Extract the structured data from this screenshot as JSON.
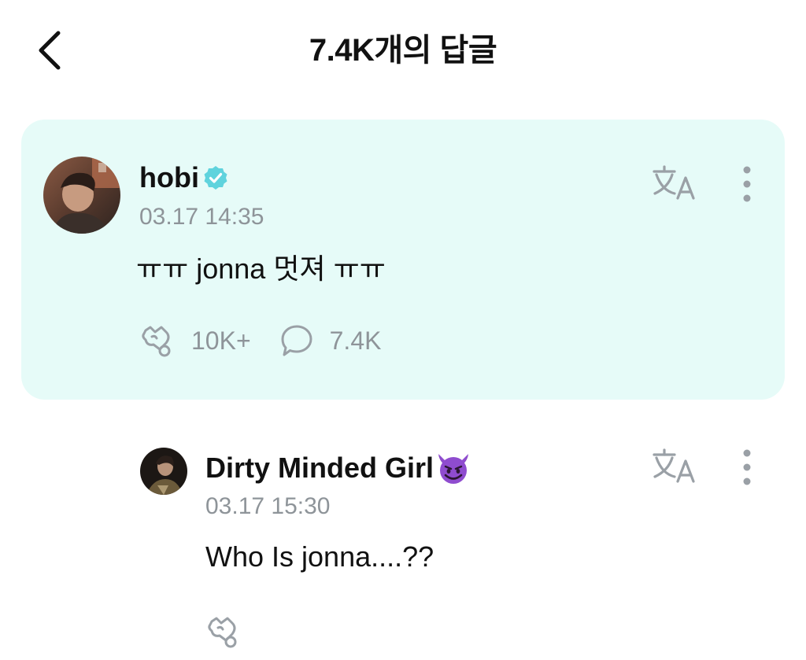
{
  "header": {
    "title": "7.4K개의 답글",
    "back_icon": "chevron-left-icon"
  },
  "post": {
    "author": "hobi",
    "verified": true,
    "verified_color": "#5fd3dd",
    "timestamp": "03.17 14:35",
    "body": "ㅠㅠ jonna 멋져 ㅠㅠ",
    "like_count": "10K+",
    "comment_count": "7.4K",
    "background_color": "#e6fbf8",
    "icons": [
      "translate-icon",
      "more-vertical-icon",
      "like-icon",
      "comment-icon"
    ]
  },
  "reply": {
    "author": "Dirty Minded Girl",
    "author_emoji": "smiling-devil-icon",
    "timestamp": "03.17 15:30",
    "body": "Who Is jonna....??",
    "icons": [
      "translate-icon",
      "more-vertical-icon",
      "like-icon"
    ]
  },
  "colors": {
    "muted_text": "#8e9499",
    "icon_gray": "#9aa0a6",
    "accent": "#5fd3dd"
  }
}
